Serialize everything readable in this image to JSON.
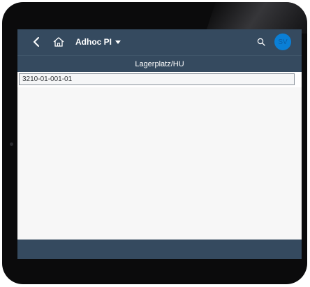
{
  "shell": {
    "app_title": "Adhoc PI",
    "avatar_initials": "SV",
    "colors": {
      "shell_bg": "#354a5f",
      "avatar_bg": "#0a7fd6"
    },
    "icons": {
      "back": "back-icon",
      "home": "home-icon",
      "search": "search-icon",
      "menu": "caret-down-icon"
    }
  },
  "sub_header": {
    "title": "Lagerplatz/HU"
  },
  "form": {
    "storage_bin_value": "3210-01-001-01"
  }
}
